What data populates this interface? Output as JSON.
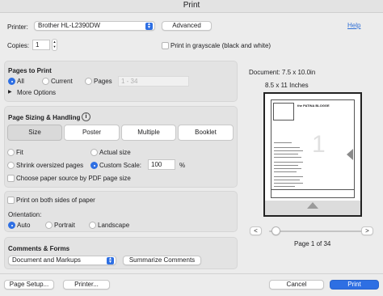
{
  "window": {
    "title": "Print"
  },
  "printer": {
    "label": "Printer:",
    "value": "Brother HL-L2390DW",
    "advanced_label": "Advanced",
    "help_label": "Help"
  },
  "copies": {
    "label": "Copies:",
    "value": "1",
    "grayscale_label": "Print in grayscale (black and white)"
  },
  "pages_to_print": {
    "title": "Pages to Print",
    "all_label": "All",
    "current_label": "Current",
    "pages_label": "Pages",
    "pages_placeholder": "1 - 34",
    "more_options_label": "More Options",
    "selected": "All"
  },
  "sizing": {
    "title": "Page Sizing & Handling",
    "info_icon": "i",
    "tabs": [
      "Size",
      "Poster",
      "Multiple",
      "Booklet"
    ],
    "active_tab": "Size",
    "fit_label": "Fit",
    "actual_size_label": "Actual size",
    "shrink_label": "Shrink oversized pages",
    "custom_scale_label": "Custom Scale:",
    "custom_scale_value": "100",
    "percent_label": "%",
    "paper_source_label": "Choose paper source by PDF page size",
    "selected": "Custom Scale"
  },
  "duplex": {
    "label": "Print on both sides of paper"
  },
  "orientation": {
    "title": "Orientation:",
    "auto_label": "Auto",
    "portrait_label": "Portrait",
    "landscape_label": "Landscape",
    "selected": "Auto"
  },
  "comments": {
    "title": "Comments & Forms",
    "dropdown_value": "Document and Markups",
    "summarize_label": "Summarize Comments"
  },
  "preview": {
    "document_size": "Document: 7.5 x 10.0in",
    "paper_size": "8.5 x 11 Inches",
    "prev_label": "<",
    "next_label": ">",
    "page_indicator": "Page 1 of 34",
    "page_number_glyph": "1",
    "header_text": "the PATINA BLOGGE",
    "slider_position": 0
  },
  "footer": {
    "page_setup_label": "Page Setup...",
    "printer_label": "Printer...",
    "cancel_label": "Cancel",
    "print_label": "Print"
  },
  "colors": {
    "accent": "#2e6fe3",
    "panel": "#e3e3e3",
    "background": "#ececec"
  }
}
